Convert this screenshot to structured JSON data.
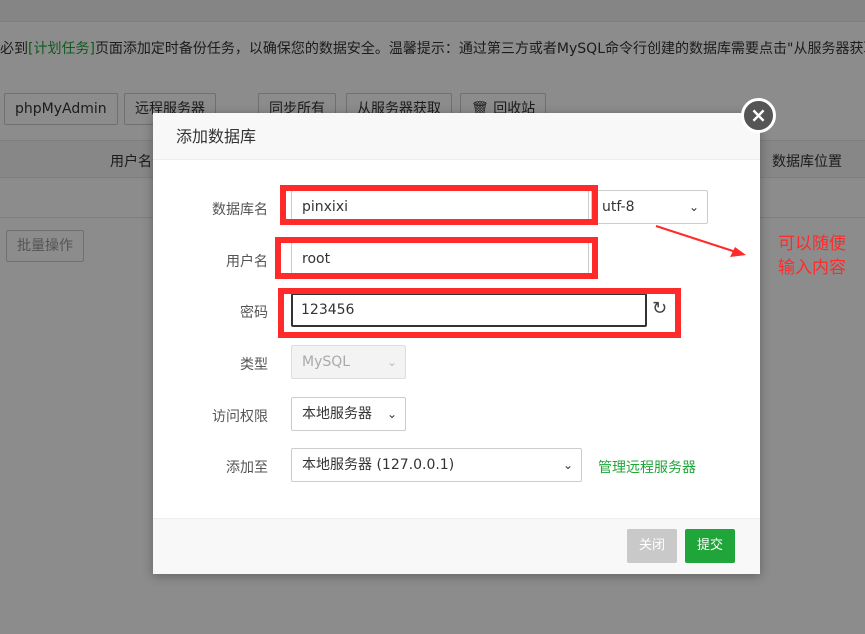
{
  "background": {
    "notice_prefix": "必到",
    "notice_link": "[计划任务]",
    "notice_suffix": "页面添加定时备份任务，以确保您的数据安全。温馨提示：通过第三方或者MySQL命令行创建的数据库需要点击\"从服务器获取\"按",
    "toolbar": [
      "phpMyAdmin",
      "远程服务器",
      "同步所有",
      "从服务器获取",
      "回收站"
    ],
    "table_headers": [
      "用户名",
      "数据库位置"
    ],
    "batch_button": "批量操作"
  },
  "dialog": {
    "title": "添加数据库",
    "fields": {
      "db_name_label": "数据库名",
      "db_name_value": "pinxixi",
      "charset": "utf-8",
      "username_label": "用户名",
      "username_value": "root",
      "password_label": "密码",
      "password_value": "123456",
      "type_label": "类型",
      "type_value": "MySQL",
      "access_label": "访问权限",
      "access_value": "本地服务器",
      "add_to_label": "添加至",
      "add_to_value": "本地服务器 (127.0.0.1)",
      "manage_remote_link": "管理远程服务器"
    },
    "buttons": {
      "close": "关闭",
      "submit": "提交"
    },
    "close_icon": "×"
  },
  "annotation": {
    "line1": "可以随便",
    "line2": "输入内容",
    "color": "#ff2b2b"
  },
  "colors": {
    "accent_green": "#20a53a",
    "annotation_red": "#ff2b2b"
  }
}
